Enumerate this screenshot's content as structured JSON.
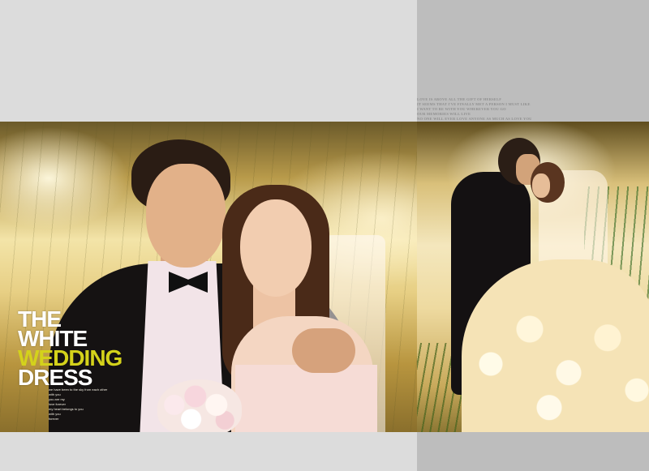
{
  "title": {
    "line1": "THE",
    "line2": "WHITE",
    "line3": "WEDDING",
    "line4": "DRESS"
  },
  "colors": {
    "accent_yellow": "#d4d21b",
    "title_white": "#ffffff",
    "band_left": "#dcdcdc",
    "band_right": "#bdbdbd"
  },
  "left_small_text": [
    "we have been to the sky from each other",
    "with you",
    "you are my",
    "love forever",
    "my heart belongs to you",
    "with you",
    "forever"
  ],
  "right_header_text": [
    "LOVE IS ABOVE ALL THE GIFT OF HERSELF",
    "IT SEEMS THAT I'VE FINALLY MET A PERSON I MUST LIKE",
    "I WANT TO BE WITH YOU WHEREVER YOU GO",
    "OUR MEMORIES WILL LIVE",
    "NO ONE WILL EVER LOVE ANYONE AS MUCH AS LOVE YOU"
  ]
}
